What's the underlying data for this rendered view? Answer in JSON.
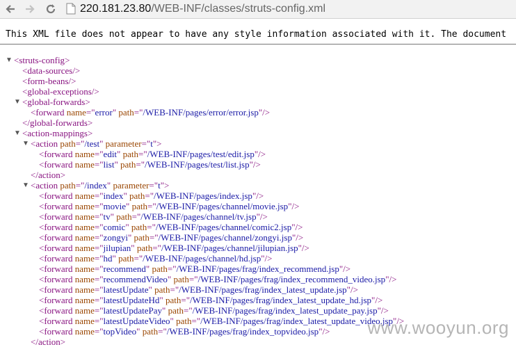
{
  "browser": {
    "url_host": "220.181.23.80",
    "url_path": "/WEB-INF/classes/struts-config.xml"
  },
  "info_text": "This XML file does not appear to have any style information associated with it. The document",
  "xml_lines": [
    {
      "indent": 0,
      "toggle": "▼",
      "parts": [
        [
          "p",
          "<"
        ],
        [
          "t",
          "struts-config"
        ],
        [
          "p",
          ">"
        ]
      ]
    },
    {
      "indent": 1,
      "parts": [
        [
          "p",
          "<"
        ],
        [
          "t",
          "data-sources"
        ],
        [
          "p",
          "/>"
        ]
      ]
    },
    {
      "indent": 1,
      "parts": [
        [
          "p",
          "<"
        ],
        [
          "t",
          "form-beans"
        ],
        [
          "p",
          "/>"
        ]
      ]
    },
    {
      "indent": 1,
      "parts": [
        [
          "p",
          "<"
        ],
        [
          "t",
          "global-exceptions"
        ],
        [
          "p",
          "/>"
        ]
      ]
    },
    {
      "indent": 1,
      "toggle": "▼",
      "parts": [
        [
          "p",
          "<"
        ],
        [
          "t",
          "global-forwards"
        ],
        [
          "p",
          ">"
        ]
      ]
    },
    {
      "indent": 2,
      "parts": [
        [
          "p",
          "<"
        ],
        [
          "t",
          "forward"
        ],
        [
          "s",
          " "
        ],
        [
          "a",
          "name"
        ],
        [
          "p",
          "=\""
        ],
        [
          "v",
          "error"
        ],
        [
          "p",
          "\""
        ],
        [
          "s",
          " "
        ],
        [
          "a",
          "path"
        ],
        [
          "p",
          "=\""
        ],
        [
          "v",
          "/WEB-INF/pages/error/error.jsp"
        ],
        [
          "p",
          "\"/>"
        ]
      ]
    },
    {
      "indent": 1,
      "parts": [
        [
          "p",
          "</"
        ],
        [
          "t",
          "global-forwards"
        ],
        [
          "p",
          ">"
        ]
      ]
    },
    {
      "indent": 1,
      "toggle": "▼",
      "parts": [
        [
          "p",
          "<"
        ],
        [
          "t",
          "action-mappings"
        ],
        [
          "p",
          ">"
        ]
      ]
    },
    {
      "indent": 2,
      "toggle": "▼",
      "parts": [
        [
          "p",
          "<"
        ],
        [
          "t",
          "action"
        ],
        [
          "s",
          " "
        ],
        [
          "a",
          "path"
        ],
        [
          "p",
          "=\""
        ],
        [
          "v",
          "/test"
        ],
        [
          "p",
          "\""
        ],
        [
          "s",
          " "
        ],
        [
          "a",
          "parameter"
        ],
        [
          "p",
          "=\""
        ],
        [
          "v",
          "t"
        ],
        [
          "p",
          "\">"
        ]
      ]
    },
    {
      "indent": 3,
      "parts": [
        [
          "p",
          "<"
        ],
        [
          "t",
          "forward"
        ],
        [
          "s",
          " "
        ],
        [
          "a",
          "name"
        ],
        [
          "p",
          "=\""
        ],
        [
          "v",
          "edit"
        ],
        [
          "p",
          "\""
        ],
        [
          "s",
          " "
        ],
        [
          "a",
          "path"
        ],
        [
          "p",
          "=\""
        ],
        [
          "v",
          "/WEB-INF/pages/test/edit.jsp"
        ],
        [
          "p",
          "\"/>"
        ]
      ]
    },
    {
      "indent": 3,
      "parts": [
        [
          "p",
          "<"
        ],
        [
          "t",
          "forward"
        ],
        [
          "s",
          " "
        ],
        [
          "a",
          "name"
        ],
        [
          "p",
          "=\""
        ],
        [
          "v",
          "list"
        ],
        [
          "p",
          "\""
        ],
        [
          "s",
          " "
        ],
        [
          "a",
          "path"
        ],
        [
          "p",
          "=\""
        ],
        [
          "v",
          "/WEB-INF/pages/test/list.jsp"
        ],
        [
          "p",
          "\"/>"
        ]
      ]
    },
    {
      "indent": 2,
      "parts": [
        [
          "p",
          "</"
        ],
        [
          "t",
          "action"
        ],
        [
          "p",
          ">"
        ]
      ]
    },
    {
      "indent": 2,
      "toggle": "▼",
      "parts": [
        [
          "p",
          "<"
        ],
        [
          "t",
          "action"
        ],
        [
          "s",
          " "
        ],
        [
          "a",
          "path"
        ],
        [
          "p",
          "=\""
        ],
        [
          "v",
          "/index"
        ],
        [
          "p",
          "\""
        ],
        [
          "s",
          " "
        ],
        [
          "a",
          "parameter"
        ],
        [
          "p",
          "=\""
        ],
        [
          "v",
          "t"
        ],
        [
          "p",
          "\">"
        ]
      ]
    },
    {
      "indent": 3,
      "parts": [
        [
          "p",
          "<"
        ],
        [
          "t",
          "forward"
        ],
        [
          "s",
          " "
        ],
        [
          "a",
          "name"
        ],
        [
          "p",
          "=\""
        ],
        [
          "v",
          "index"
        ],
        [
          "p",
          "\""
        ],
        [
          "s",
          " "
        ],
        [
          "a",
          "path"
        ],
        [
          "p",
          "=\""
        ],
        [
          "v",
          "/WEB-INF/pages/index.jsp"
        ],
        [
          "p",
          "\"/>"
        ]
      ]
    },
    {
      "indent": 3,
      "parts": [
        [
          "p",
          "<"
        ],
        [
          "t",
          "forward"
        ],
        [
          "s",
          " "
        ],
        [
          "a",
          "name"
        ],
        [
          "p",
          "=\""
        ],
        [
          "v",
          "movie"
        ],
        [
          "p",
          "\""
        ],
        [
          "s",
          " "
        ],
        [
          "a",
          "path"
        ],
        [
          "p",
          "=\""
        ],
        [
          "v",
          "/WEB-INF/pages/channel/movie.jsp"
        ],
        [
          "p",
          "\"/>"
        ]
      ]
    },
    {
      "indent": 3,
      "parts": [
        [
          "p",
          "<"
        ],
        [
          "t",
          "forward"
        ],
        [
          "s",
          " "
        ],
        [
          "a",
          "name"
        ],
        [
          "p",
          "=\""
        ],
        [
          "v",
          "tv"
        ],
        [
          "p",
          "\""
        ],
        [
          "s",
          " "
        ],
        [
          "a",
          "path"
        ],
        [
          "p",
          "=\""
        ],
        [
          "v",
          "/WEB-INF/pages/channel/tv.jsp"
        ],
        [
          "p",
          "\"/>"
        ]
      ]
    },
    {
      "indent": 3,
      "parts": [
        [
          "p",
          "<"
        ],
        [
          "t",
          "forward"
        ],
        [
          "s",
          " "
        ],
        [
          "a",
          "name"
        ],
        [
          "p",
          "=\""
        ],
        [
          "v",
          "comic"
        ],
        [
          "p",
          "\""
        ],
        [
          "s",
          " "
        ],
        [
          "a",
          "path"
        ],
        [
          "p",
          "=\""
        ],
        [
          "v",
          "/WEB-INF/pages/channel/comic2.jsp"
        ],
        [
          "p",
          "\"/>"
        ]
      ]
    },
    {
      "indent": 3,
      "parts": [
        [
          "p",
          "<"
        ],
        [
          "t",
          "forward"
        ],
        [
          "s",
          " "
        ],
        [
          "a",
          "name"
        ],
        [
          "p",
          "=\""
        ],
        [
          "v",
          "zongyi"
        ],
        [
          "p",
          "\""
        ],
        [
          "s",
          " "
        ],
        [
          "a",
          "path"
        ],
        [
          "p",
          "=\""
        ],
        [
          "v",
          "/WEB-INF/pages/channel/zongyi.jsp"
        ],
        [
          "p",
          "\"/>"
        ]
      ]
    },
    {
      "indent": 3,
      "parts": [
        [
          "p",
          "<"
        ],
        [
          "t",
          "forward"
        ],
        [
          "s",
          " "
        ],
        [
          "a",
          "name"
        ],
        [
          "p",
          "=\""
        ],
        [
          "v",
          "jilupian"
        ],
        [
          "p",
          "\""
        ],
        [
          "s",
          " "
        ],
        [
          "a",
          "path"
        ],
        [
          "p",
          "=\""
        ],
        [
          "v",
          "/WEB-INF/pages/channel/jilupian.jsp"
        ],
        [
          "p",
          "\"/>"
        ]
      ]
    },
    {
      "indent": 3,
      "parts": [
        [
          "p",
          "<"
        ],
        [
          "t",
          "forward"
        ],
        [
          "s",
          " "
        ],
        [
          "a",
          "name"
        ],
        [
          "p",
          "=\""
        ],
        [
          "v",
          "hd"
        ],
        [
          "p",
          "\""
        ],
        [
          "s",
          " "
        ],
        [
          "a",
          "path"
        ],
        [
          "p",
          "=\""
        ],
        [
          "v",
          "/WEB-INF/pages/channel/hd.jsp"
        ],
        [
          "p",
          "\"/>"
        ]
      ]
    },
    {
      "indent": 3,
      "parts": [
        [
          "p",
          "<"
        ],
        [
          "t",
          "forward"
        ],
        [
          "s",
          " "
        ],
        [
          "a",
          "name"
        ],
        [
          "p",
          "=\""
        ],
        [
          "v",
          "recommend"
        ],
        [
          "p",
          "\""
        ],
        [
          "s",
          " "
        ],
        [
          "a",
          "path"
        ],
        [
          "p",
          "=\""
        ],
        [
          "v",
          "/WEB-INF/pages/frag/index_recommend.jsp"
        ],
        [
          "p",
          "\"/>"
        ]
      ]
    },
    {
      "indent": 3,
      "parts": [
        [
          "p",
          "<"
        ],
        [
          "t",
          "forward"
        ],
        [
          "s",
          " "
        ],
        [
          "a",
          "name"
        ],
        [
          "p",
          "=\""
        ],
        [
          "v",
          "recommendVideo"
        ],
        [
          "p",
          "\""
        ],
        [
          "s",
          " "
        ],
        [
          "a",
          "path"
        ],
        [
          "p",
          "=\""
        ],
        [
          "v",
          "/WEB-INF/pages/frag/index_recommend_video.jsp"
        ],
        [
          "p",
          "\"/>"
        ]
      ]
    },
    {
      "indent": 3,
      "parts": [
        [
          "p",
          "<"
        ],
        [
          "t",
          "forward"
        ],
        [
          "s",
          " "
        ],
        [
          "a",
          "name"
        ],
        [
          "p",
          "=\""
        ],
        [
          "v",
          "latestUpdate"
        ],
        [
          "p",
          "\""
        ],
        [
          "s",
          " "
        ],
        [
          "a",
          "path"
        ],
        [
          "p",
          "=\""
        ],
        [
          "v",
          "/WEB-INF/pages/frag/index_latest_update.jsp"
        ],
        [
          "p",
          "\"/>"
        ]
      ]
    },
    {
      "indent": 3,
      "parts": [
        [
          "p",
          "<"
        ],
        [
          "t",
          "forward"
        ],
        [
          "s",
          " "
        ],
        [
          "a",
          "name"
        ],
        [
          "p",
          "=\""
        ],
        [
          "v",
          "latestUpdateHd"
        ],
        [
          "p",
          "\""
        ],
        [
          "s",
          " "
        ],
        [
          "a",
          "path"
        ],
        [
          "p",
          "=\""
        ],
        [
          "v",
          "/WEB-INF/pages/frag/index_latest_update_hd.jsp"
        ],
        [
          "p",
          "\"/>"
        ]
      ]
    },
    {
      "indent": 3,
      "parts": [
        [
          "p",
          "<"
        ],
        [
          "t",
          "forward"
        ],
        [
          "s",
          " "
        ],
        [
          "a",
          "name"
        ],
        [
          "p",
          "=\""
        ],
        [
          "v",
          "latestUpdatePay"
        ],
        [
          "p",
          "\""
        ],
        [
          "s",
          " "
        ],
        [
          "a",
          "path"
        ],
        [
          "p",
          "=\""
        ],
        [
          "v",
          "/WEB-INF/pages/frag/index_latest_update_pay.jsp"
        ],
        [
          "p",
          "\"/>"
        ]
      ]
    },
    {
      "indent": 3,
      "parts": [
        [
          "p",
          "<"
        ],
        [
          "t",
          "forward"
        ],
        [
          "s",
          " "
        ],
        [
          "a",
          "name"
        ],
        [
          "p",
          "=\""
        ],
        [
          "v",
          "latestUpdateVideo"
        ],
        [
          "p",
          "\""
        ],
        [
          "s",
          " "
        ],
        [
          "a",
          "path"
        ],
        [
          "p",
          "=\""
        ],
        [
          "v",
          "/WEB-INF/pages/frag/index_latest_update_video.jsp"
        ],
        [
          "p",
          "\"/>"
        ]
      ]
    },
    {
      "indent": 3,
      "parts": [
        [
          "p",
          "<"
        ],
        [
          "t",
          "forward"
        ],
        [
          "s",
          " "
        ],
        [
          "a",
          "name"
        ],
        [
          "p",
          "=\""
        ],
        [
          "v",
          "topVideo"
        ],
        [
          "p",
          "\""
        ],
        [
          "s",
          " "
        ],
        [
          "a",
          "path"
        ],
        [
          "p",
          "=\""
        ],
        [
          "v",
          "/WEB-INF/pages/frag/index_topvideo.jsp"
        ],
        [
          "p",
          "\"/>"
        ]
      ]
    },
    {
      "indent": 2,
      "parts": [
        [
          "p",
          "</"
        ],
        [
          "t",
          "action"
        ],
        [
          "p",
          ">"
        ]
      ]
    }
  ],
  "watermark": "www.wooyun.org"
}
